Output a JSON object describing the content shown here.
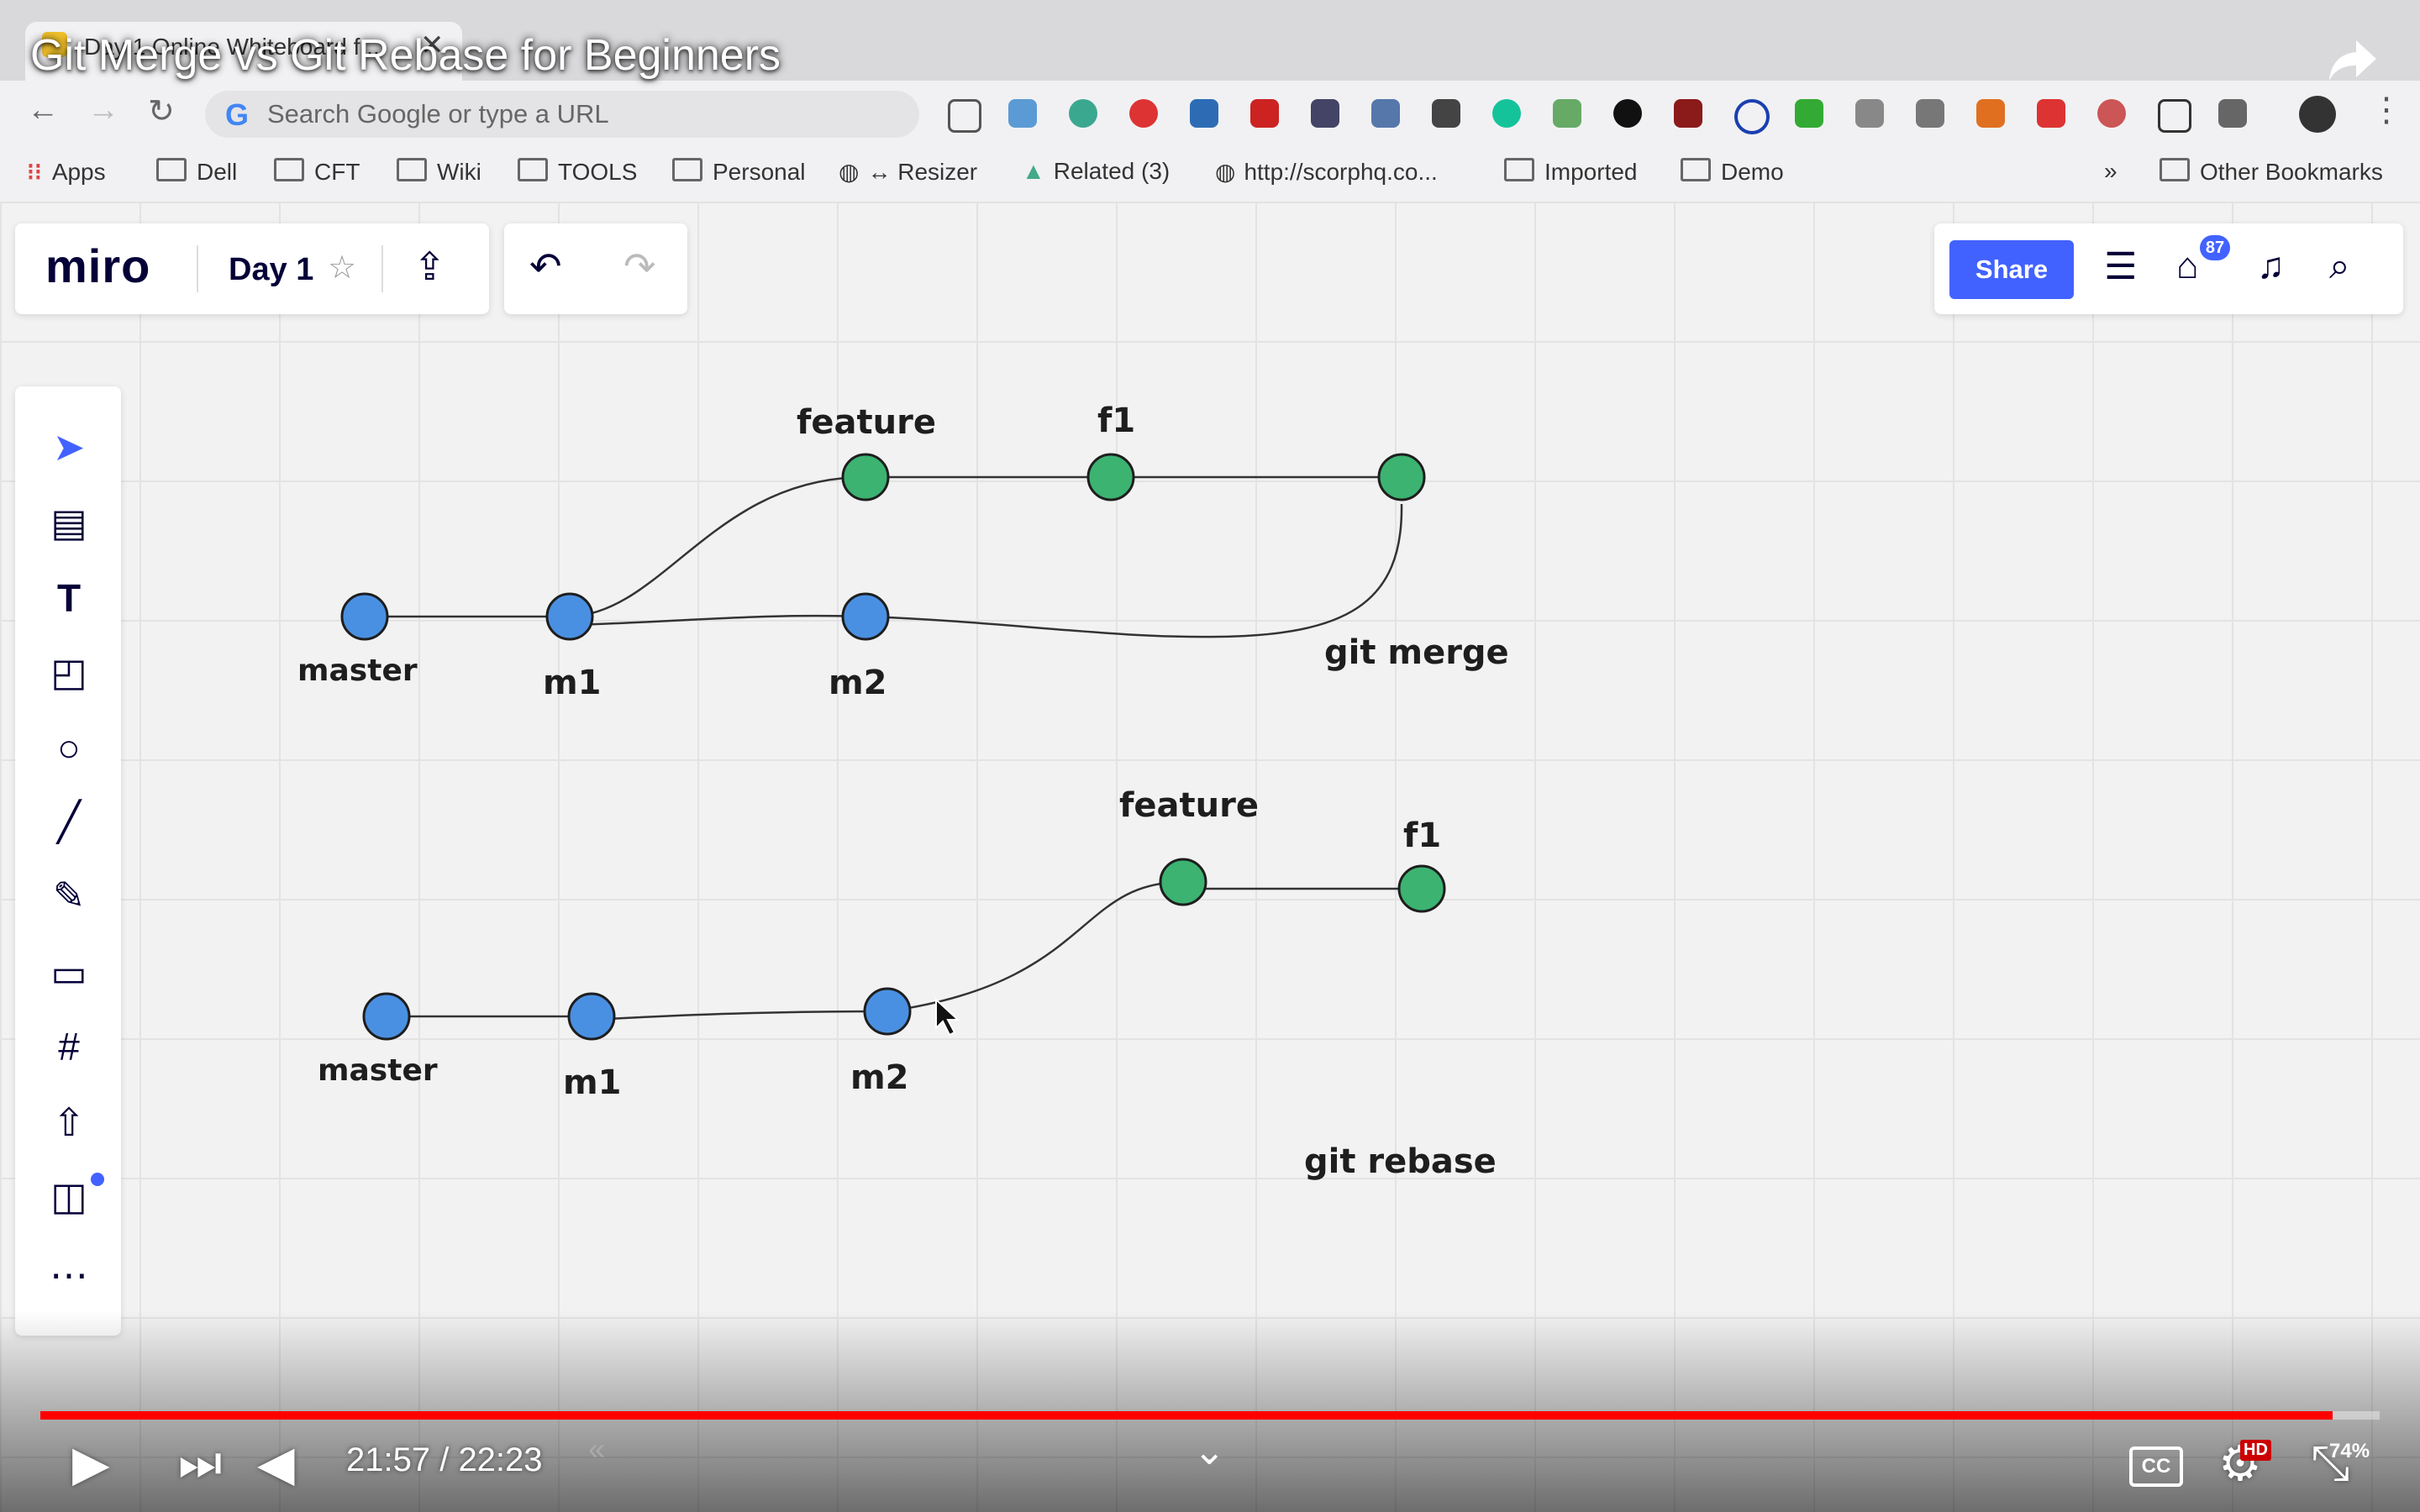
{
  "browser": {
    "tab_title": "Day 1 Online Whiteboard f...",
    "tab_close": "✕",
    "omnibox_placeholder": "Search Google or type a URL",
    "bookmarks": [
      "Apps",
      "Dell",
      "CFT",
      "Wiki",
      "TOOLS",
      "Personal",
      "↔ Resizer",
      "Related (3)",
      "http://scorphq.co...",
      "Imported",
      "Demo"
    ],
    "bookmarks_more": "»",
    "other_bookmarks": "Other Bookmarks"
  },
  "video": {
    "title": "Git Merge vs Git Rebase for Beginners",
    "time": "21:57 / 22:23",
    "progress": 0.98,
    "cc": "CC",
    "hd": "HD",
    "zoom": "74%"
  },
  "miro": {
    "logo": "miro",
    "board_name": "Day 1",
    "share": "Share",
    "notifications": "87",
    "accent": "#4262ff"
  },
  "diagram": {
    "merge": {
      "master": "master",
      "m1": "m1",
      "m2": "m2",
      "feature": "feature",
      "f1": "f1",
      "caption": "git merge"
    },
    "rebase": {
      "master": "master",
      "m1": "m1",
      "m2": "m2",
      "feature": "feature",
      "f1": "f1",
      "caption": "git rebase"
    },
    "colors": {
      "master": "#4a90e2",
      "feature": "#3cb371"
    }
  }
}
